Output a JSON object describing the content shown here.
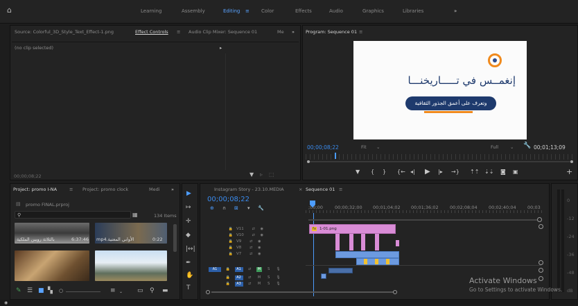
{
  "workspace": {
    "home_icon": "home-icon",
    "tabs": [
      "Learning",
      "Assembly",
      "Editing",
      "Color",
      "Effects",
      "Audio",
      "Graphics",
      "Libraries"
    ],
    "active": "Editing",
    "more": "»"
  },
  "source_panel": {
    "tabs": [
      "Source: Colorful_3D_Style_Text_Effect-1.png",
      "Effect Controls",
      "Audio Clip Mixer: Sequence 01",
      "Me",
      "»"
    ],
    "no_clip": "(no clip selected)",
    "timecode": "00;00;08;22"
  },
  "program": {
    "title": "Program: Sequence 01",
    "timecode": "00;00;08;22",
    "fit": "Fit",
    "quality": "Full",
    "duration": "00;01;13;09",
    "title_text": "إنغمــس في تـــــاريخنـــا",
    "subtitle_text": "وتعرف على أعمق الجذور الثقافية"
  },
  "project": {
    "tabs": [
      "Project: promo I-NA",
      "Project: promo clock",
      "Medi",
      "»"
    ],
    "file": "promo FINAL.prproj",
    "items_count": "134 Items",
    "search_placeholder": "",
    "clips": [
      {
        "name": "بالثلاثة روبين الملكية",
        "dur": "6:37:46"
      },
      {
        "name": "mp4.الأوابي المعتية",
        "dur": "0:22"
      }
    ]
  },
  "sequence": {
    "tabs": [
      "Instagram Story - 23.10.MEDIA",
      "Sequence 01"
    ],
    "timecode": "00;00;08;22",
    "ruler": [
      ";00;00",
      "00;00;32;00",
      "00;01;04;02",
      "00;01;36;02",
      "00;02;08;04",
      "00;02;40;04",
      "00;03"
    ],
    "video_tracks": [
      "V11",
      "V10",
      "V9",
      "V8",
      "V7"
    ],
    "audio_tracks": [
      "A1",
      "A2",
      "A3"
    ],
    "source_patch": "A1",
    "clip_label": "1-01.png"
  },
  "meter": {
    "labels": [
      "0",
      "-12",
      "-24",
      "-36",
      "-48",
      "dB"
    ]
  },
  "watermark": {
    "title": "Activate Windows",
    "sub": "Go to Settings to activate Windows."
  },
  "colors": {
    "accent": "#2d8ceb",
    "clip_pink": "#d98cd6",
    "clip_blue": "#6c9ae0",
    "audio_green": "#3e9b5b"
  }
}
